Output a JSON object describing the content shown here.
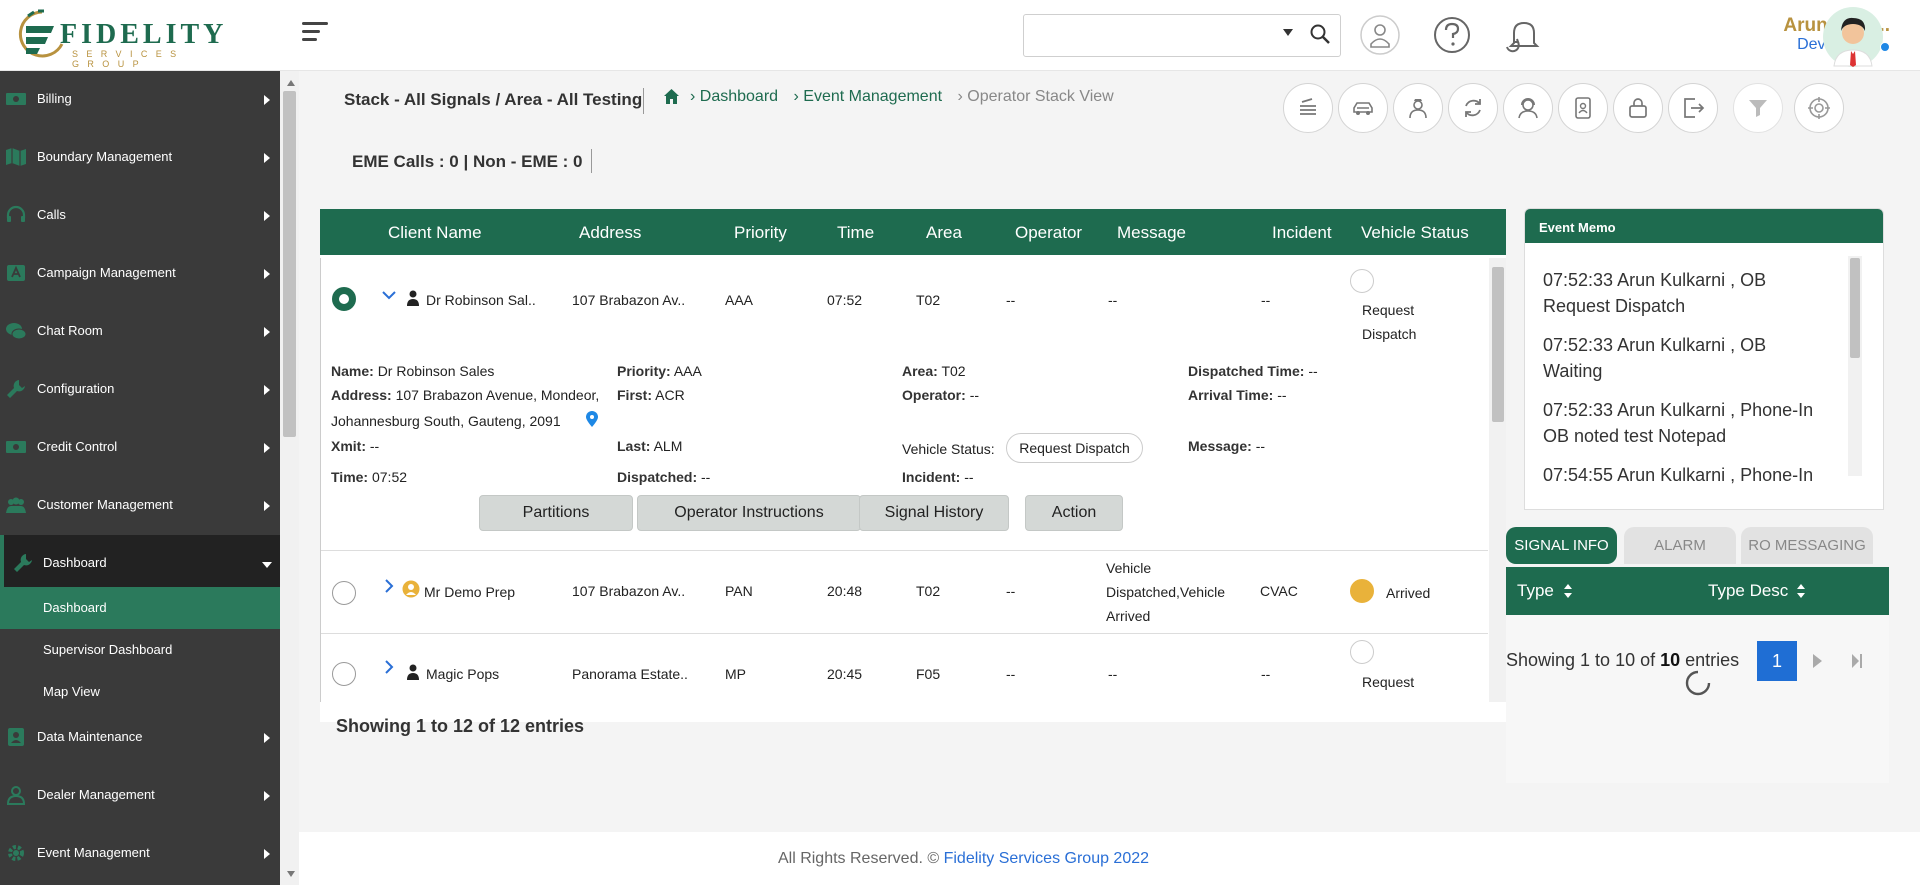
{
  "header": {
    "logo_word": "FIDELITY",
    "logo_sub": "SERVICES GROUP",
    "search": {
      "placeholder": "",
      "value": ""
    },
    "user_name": "Arun Kulk...",
    "user_role": "Developers",
    "colors": {
      "brand": "#1e6b4f",
      "gold": "#b8923f",
      "link": "#2a6fd6"
    }
  },
  "sidebar": {
    "items": [
      {
        "label": "Billing",
        "icon": "money-icon"
      },
      {
        "label": "Boundary Management",
        "icon": "map-icon"
      },
      {
        "label": "Calls",
        "icon": "headset-icon"
      },
      {
        "label": "Campaign Management",
        "icon": "campaign-icon"
      },
      {
        "label": "Chat Room",
        "icon": "chat-icon"
      },
      {
        "label": "Configuration",
        "icon": "wrench-icon"
      },
      {
        "label": "Credit Control",
        "icon": "money-icon"
      },
      {
        "label": "Customer Management",
        "icon": "users-icon"
      },
      {
        "label": "Dashboard",
        "icon": "wrench-icon"
      },
      {
        "label": "Data Maintenance",
        "icon": "person-icon"
      },
      {
        "label": "Dealer Management",
        "icon": "user-outline-icon"
      },
      {
        "label": "Event Management",
        "icon": "gear-icon"
      }
    ],
    "dashboard_sub": [
      "Dashboard",
      "Supervisor Dashboard",
      "Map View"
    ]
  },
  "page": {
    "title": "Stack - All Signals / Area - All Testing",
    "breadcrumb": [
      "Dashboard",
      "Event Management"
    ],
    "breadcrumb_current": "Operator Stack View",
    "breadcrumb_sep": "›",
    "eme_calls": "EME Calls : 0 | Non - EME : 0"
  },
  "table": {
    "columns": [
      "Client Name",
      "Address",
      "Priority",
      "Time",
      "Area",
      "Operator",
      "Message",
      "Incident",
      "Vehicle Status"
    ],
    "rows": [
      {
        "client": "Dr Robinson Sal..",
        "address": "107 Brabazon Av..",
        "priority": "AAA",
        "time": "07:52",
        "area": "T02",
        "operator": "--",
        "message": "--",
        "incident": "--",
        "status_line1": "Request",
        "status_line2": "Dispatch"
      },
      {
        "client": "Mr Demo Prep",
        "address": "107 Brabazon Av..",
        "priority": "PAN",
        "time": "20:48",
        "area": "T02",
        "operator": "--",
        "message_line1": "Vehicle",
        "message_line2": "Dispatched,Vehicle",
        "message_line3": "Arrived",
        "incident": "CVAC",
        "status": "Arrived"
      },
      {
        "client": "Magic Pops",
        "address": "Panorama Estate..",
        "priority": "MP",
        "time": "20:45",
        "area": "F05",
        "operator": "--",
        "message": "--",
        "incident": "--",
        "status_line1": "Request"
      }
    ],
    "detail": {
      "name_label": "Name:",
      "name": "Dr Robinson Sales",
      "address_label": "Address:",
      "address_line1": "107 Brabazon Avenue, Mondeor,",
      "address_line2": "Johannesburg South, Gauteng, 2091",
      "xmit_label": "Xmit:",
      "xmit": "--",
      "time_label": "Time:",
      "time": "07:52",
      "priority_label": "Priority:",
      "priority": "AAA",
      "first_label": "First:",
      "first": "ACR",
      "last_label": "Last:",
      "last": "ALM",
      "dispatched_label": "Dispatched:",
      "dispatched": "--",
      "area_label": "Area:",
      "area": "T02",
      "operator_label": "Operator:",
      "operator": "--",
      "vehicle_status_label": "Vehicle Status:",
      "vehicle_status": "Request Dispatch",
      "incident_label": "Incident:",
      "incident": "--",
      "dispatched_time_label": "Dispatched Time:",
      "dispatched_time": "--",
      "arrival_time_label": "Arrival Time:",
      "arrival_time": "--",
      "message_label": "Message:",
      "message": "--",
      "buttons": [
        "Partitions",
        "Operator Instructions",
        "Signal History",
        "Action"
      ]
    },
    "showing": "Showing 1 to 12 of 12 entries"
  },
  "memo": {
    "title": "Event Memo",
    "entries": [
      {
        "line1": "07:52:33 Arun Kulkarni , OB",
        "line2": "Request Dispatch"
      },
      {
        "line1": "07:52:33 Arun Kulkarni , OB",
        "line2": "Waiting"
      },
      {
        "line1": "07:52:33 Arun Kulkarni , Phone-In",
        "line2": "OB noted test Notepad"
      },
      {
        "line1": "07:54:55 Arun Kulkarni , Phone-In",
        "line2": ""
      }
    ]
  },
  "signal": {
    "tabs": [
      "SIGNAL INFO",
      "ALARM",
      "RO MESSAGING"
    ],
    "columns": [
      "Type",
      "Type Desc"
    ],
    "showing_prefix": "Showing 1 to 10 of ",
    "showing_total": "10",
    "showing_suffix": " entries",
    "page": "1"
  },
  "footer": {
    "text": "All Rights Reserved. © ",
    "link": "Fidelity Services Group 2022"
  }
}
